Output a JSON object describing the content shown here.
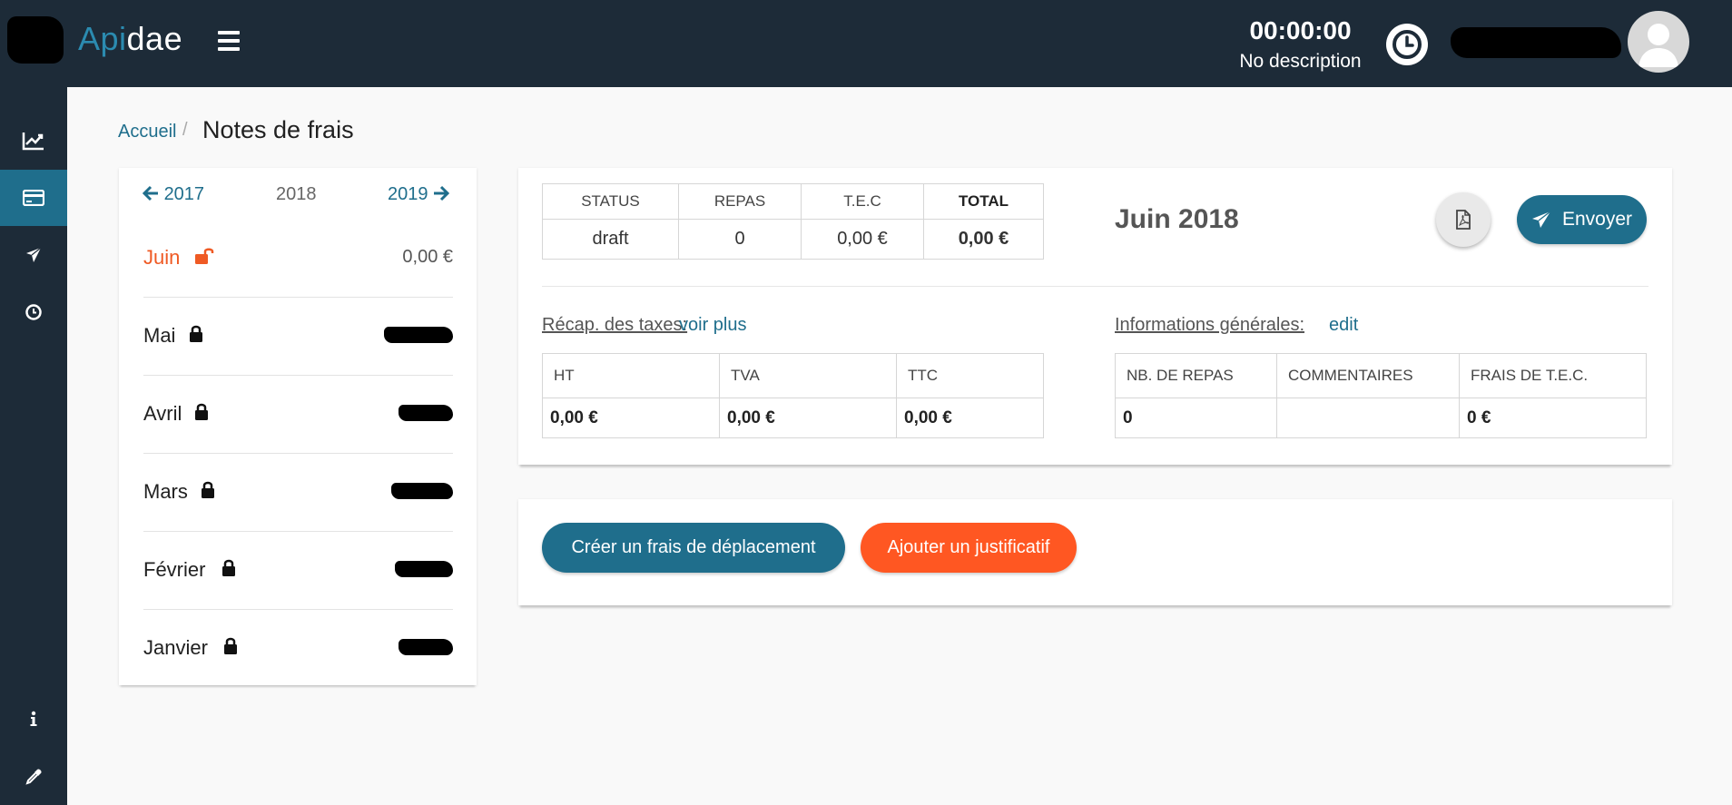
{
  "app": {
    "logo_part1": "Api",
    "logo_part2": "dae"
  },
  "header": {
    "timer": "00:00:00",
    "timer_description": "No description",
    "icons": {
      "menu": "hamburger-icon",
      "clock": "clock-icon",
      "avatar": "user-avatar-icon"
    }
  },
  "sidebar": {
    "items": [
      {
        "icon": "chart-line-icon",
        "active": false
      },
      {
        "icon": "credit-card-icon",
        "active": true
      },
      {
        "icon": "plane-icon",
        "active": false
      },
      {
        "icon": "clock-icon",
        "active": false
      },
      {
        "icon": "info-icon",
        "active": false
      },
      {
        "icon": "eyedropper-icon",
        "active": false
      }
    ]
  },
  "breadcrumb": {
    "home": "Accueil",
    "separator": "/",
    "current": "Notes de frais"
  },
  "months_panel": {
    "prev_year": "2017",
    "current_year": "2018",
    "next_year": "2019",
    "months": [
      {
        "name": "Juin",
        "amount": "0,00 €",
        "locked": false,
        "current": true
      },
      {
        "name": "Mai",
        "amount": "",
        "locked": true,
        "current": false
      },
      {
        "name": "Avril",
        "amount": "",
        "locked": true,
        "current": false
      },
      {
        "name": "Mars",
        "amount": "",
        "locked": true,
        "current": false
      },
      {
        "name": "Février",
        "amount": "",
        "locked": true,
        "current": false
      },
      {
        "name": "Janvier",
        "amount": "",
        "locked": true,
        "current": false
      }
    ]
  },
  "summary": {
    "headers": {
      "status": "STATUS",
      "repas": "REPAS",
      "tec": "T.E.C",
      "total": "TOTAL"
    },
    "values": {
      "status": "draft",
      "repas": "0",
      "tec": "0,00 €",
      "total": "0,00 €"
    },
    "period_title": "Juin 2018",
    "send_label": "Envoyer"
  },
  "taxes": {
    "label": "Récap. des taxes:",
    "link": "voir plus",
    "headers": {
      "ht": "HT",
      "tva": "TVA",
      "ttc": "TTC"
    },
    "values": {
      "ht": "0,00 €",
      "tva": "0,00 €",
      "ttc": "0,00 €"
    }
  },
  "general_info": {
    "label": "Informations générales:",
    "link": "edit",
    "headers": {
      "nb_repas": "NB. DE REPAS",
      "commentaires": "COMMENTAIRES",
      "frais_tec": "FRAIS DE T.E.C."
    },
    "values": {
      "nb_repas": "0",
      "commentaires": "",
      "frais_tec": "0 €"
    }
  },
  "actions": {
    "create_label": "Créer un frais de déplacement",
    "add_label": "Ajouter un justificatif"
  },
  "colors": {
    "primary": "#1f6e8c",
    "accent": "#ff5722",
    "dark": "#1d2b38",
    "current_month": "#ef5a24"
  }
}
